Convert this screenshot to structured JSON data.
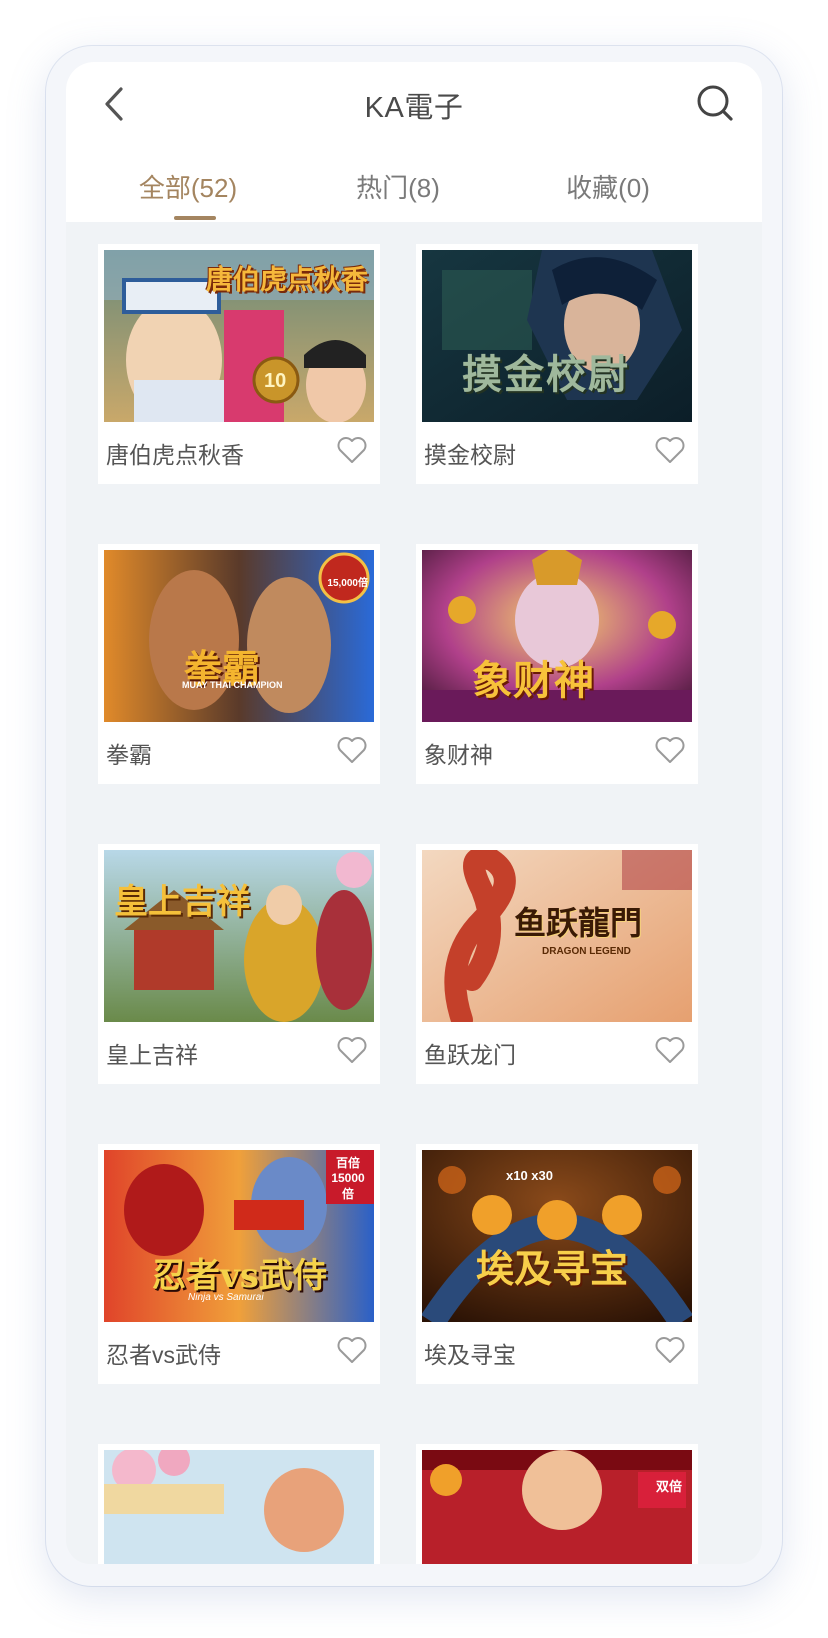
{
  "header": {
    "title": "KA電子",
    "back_icon": "chevron-left-icon",
    "search_icon": "search-icon"
  },
  "tabs": [
    {
      "label": "全部(52)",
      "active": true
    },
    {
      "label": "热门(8)",
      "active": false
    },
    {
      "label": "收藏(0)",
      "active": false
    }
  ],
  "colors": {
    "accent": "#a48560",
    "page_bg": "#f0f3f6",
    "card_bg": "#ffffff"
  },
  "games": [
    {
      "name": "唐伯虎点秋香",
      "logo": "唐伯虎点秋香",
      "badge": "10",
      "favorite": false
    },
    {
      "name": "摸金校尉",
      "logo": "摸金校尉",
      "favorite": false
    },
    {
      "name": "拳霸",
      "logo": "拳霸",
      "sub": "MUAY THAI CHAMPION",
      "badge": "15,000倍",
      "favorite": false
    },
    {
      "name": "象财神",
      "logo": "象财神",
      "favorite": false
    },
    {
      "name": "皇上吉祥",
      "logo": "皇上吉祥",
      "favorite": false
    },
    {
      "name": "鱼跃龙门",
      "logo": "鱼跃龍門",
      "sub": "DRAGON LEGEND",
      "favorite": false
    },
    {
      "name": "忍者vs武侍",
      "logo": "忍者vs武侍",
      "sub": "Ninja vs Samurai",
      "badge": "百倍 15000倍",
      "favorite": false
    },
    {
      "name": "埃及寻宝",
      "logo": "埃及寻宝",
      "badge": "x10 x30",
      "favorite": false
    },
    {
      "name": "",
      "partial": true
    },
    {
      "name": "",
      "partial": true,
      "badge": "双倍"
    }
  ]
}
